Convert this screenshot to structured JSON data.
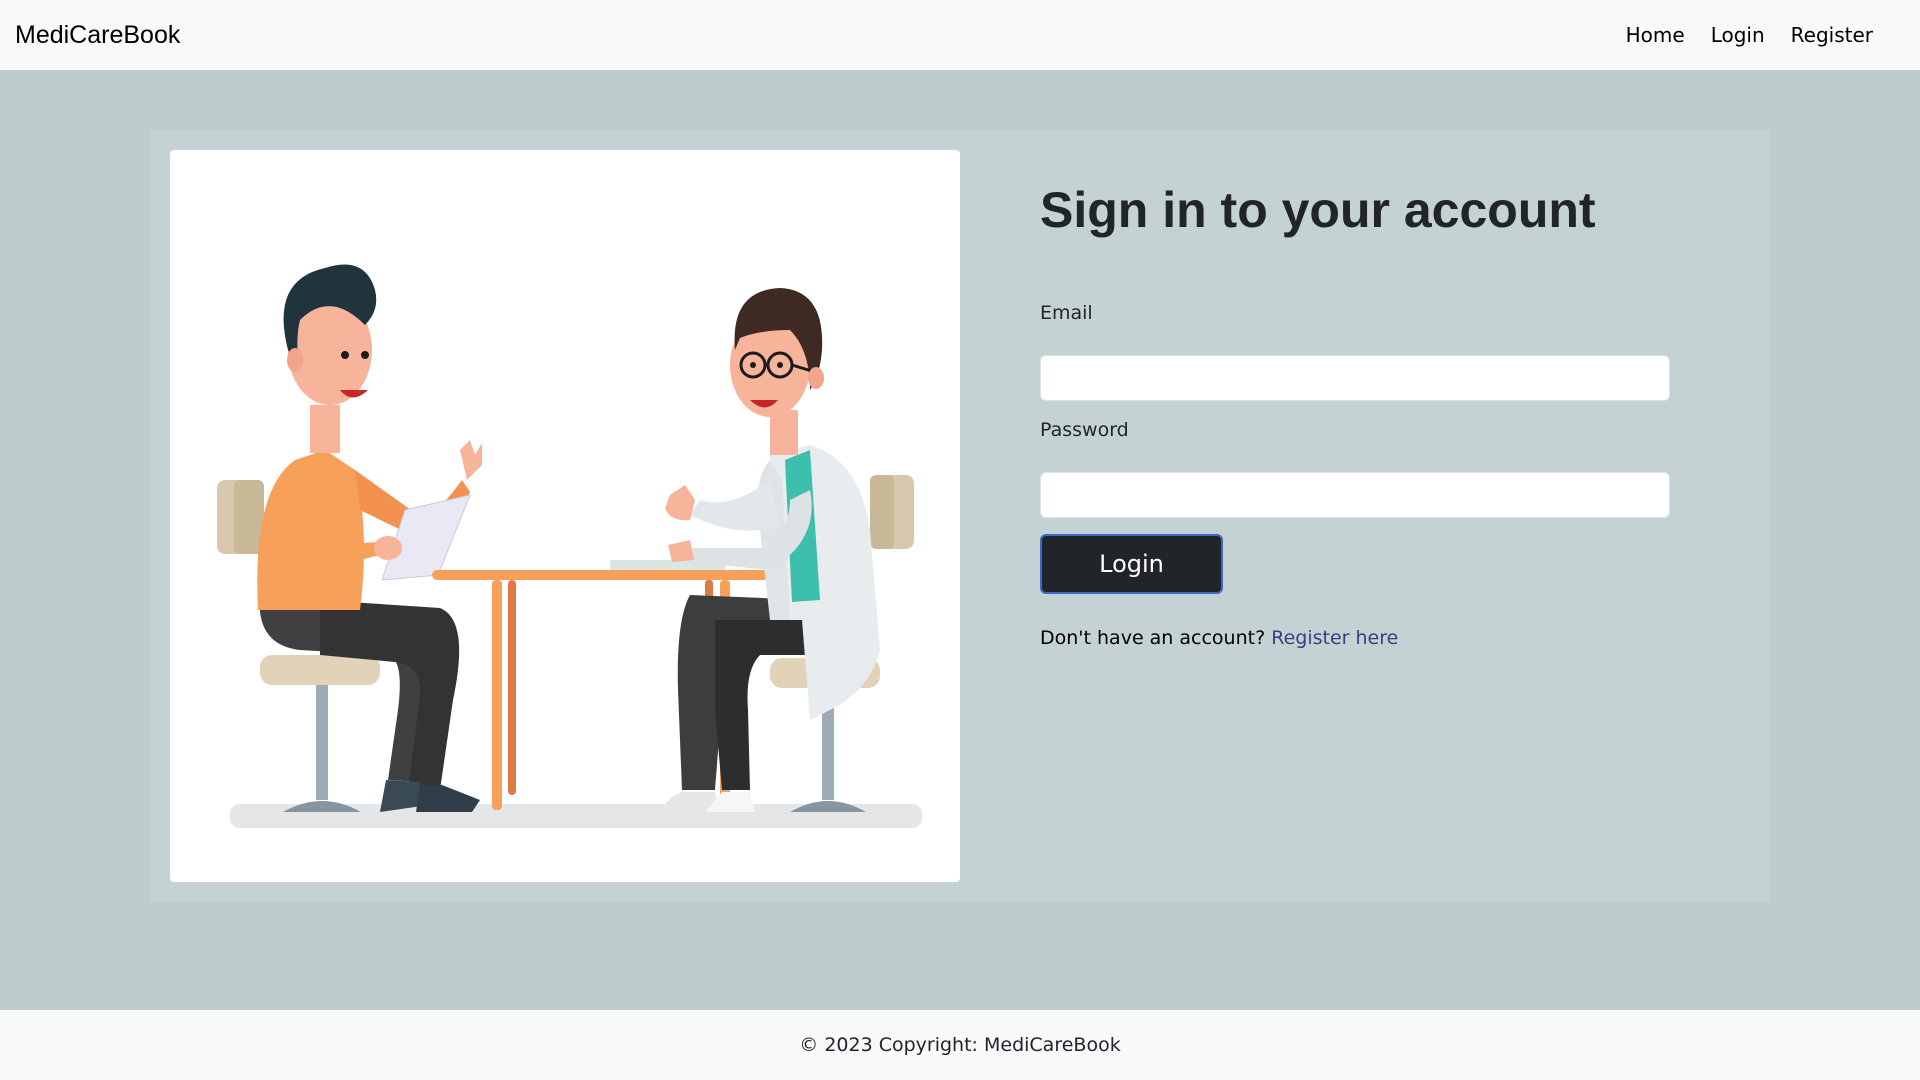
{
  "navbar": {
    "brand": "MediCareBook",
    "links": [
      {
        "label": "Home"
      },
      {
        "label": "Login"
      },
      {
        "label": "Register"
      }
    ]
  },
  "illustration": {
    "icon": "doctor-patient-consultation-illustration"
  },
  "login_form": {
    "title": "Sign in to your account",
    "email_label": "Email",
    "email_value": "",
    "password_label": "Password",
    "password_value": "",
    "submit_label": "Login",
    "register_prompt": "Don't have an account?",
    "register_link": "Register here"
  },
  "footer": {
    "copyright": "© 2023 Copyright: MediCareBook"
  },
  "colors": {
    "page_background": "#bdcccc",
    "card_background": "#c5d2d3",
    "bar_background": "#f8f9fa",
    "button_background": "#212529",
    "link_color": "#3c3c86"
  }
}
